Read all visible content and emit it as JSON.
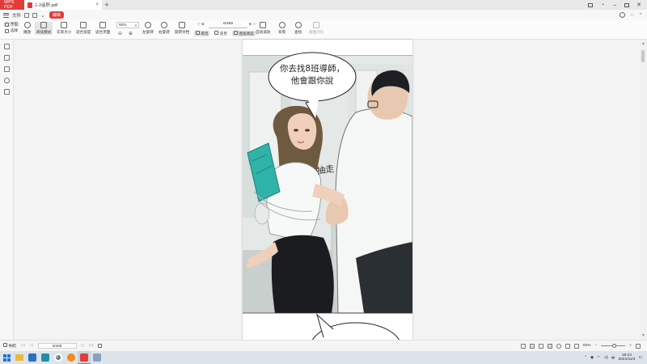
{
  "titlebar": {
    "app_tab": "WPS PDF",
    "doc_tab": "1-3话肝.pdf",
    "new_tab": "+"
  },
  "menu": {
    "file": "文件",
    "edit_badge": "编辑"
  },
  "ribbon": {
    "hand_tool": "手型",
    "select_tool": "选择",
    "play": "播放",
    "read_mode": "阅读模式",
    "actual_size": "实际大小",
    "fit_width": "适合宽度",
    "fit_page": "适合页面",
    "zoom_value": "50%",
    "zoom_out": "⊖",
    "zoom_in": "⊕",
    "page_value": "6/469",
    "rotate_left": "左旋转",
    "rotate_right": "右旋转",
    "rotate_doc": "旋转文档",
    "single_page": "单页",
    "double_page": "双页",
    "continuous": "连续阅读",
    "auto_scroll": "自动滚动",
    "background": "背景",
    "find": "查找",
    "screenshot": "截图对比"
  },
  "page": {
    "bubble_line1": "你去找8班導師，",
    "bubble_line2": "他會跟你說",
    "sfx": "抽走"
  },
  "statusbar": {
    "nav": "导航",
    "page_value": "6/469",
    "zoom_value": "50%"
  },
  "taskbar": {
    "time": "19:14",
    "date": "2021/11/4"
  }
}
